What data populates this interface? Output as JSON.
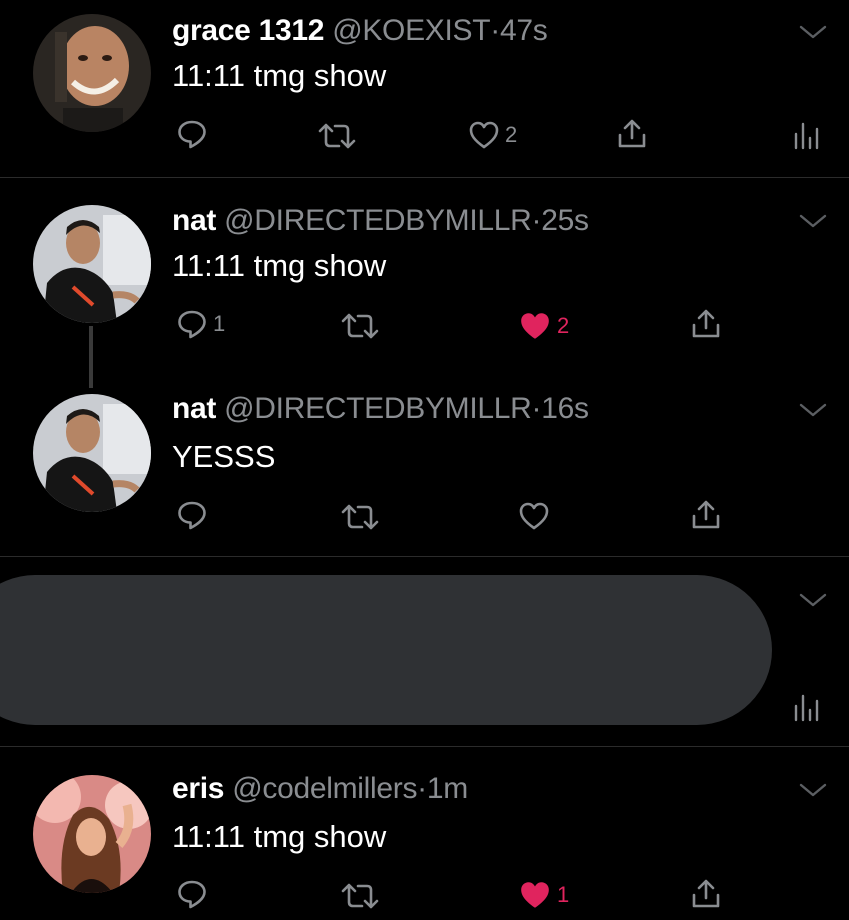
{
  "tweets": [
    {
      "name": "grace 1312",
      "handle": "@KOEXIST",
      "sep": "·",
      "time": "47s",
      "text": "11:11 tmg show",
      "reply_count": "",
      "like_count": "2"
    },
    {
      "name": "nat",
      "handle": "@DIRECTEDBYMILLR",
      "sep": "·",
      "time": "25s",
      "text": "11:11 tmg show",
      "reply_count": "1",
      "like_count": "2"
    },
    {
      "name": "nat",
      "handle": "@DIRECTEDBYMILLR",
      "sep": "·",
      "time": "16s",
      "text": "YESSS",
      "reply_count": "",
      "like_count": ""
    },
    {
      "name": "eris",
      "handle": "@codelmillers",
      "sep": "·",
      "time": "1m",
      "text": "11:11 tmg show",
      "reply_count": "",
      "like_count": "1"
    }
  ],
  "colors": {
    "background": "#000000",
    "secondary_text": "#8a8d91",
    "like_active": "#e0245e",
    "redacted_block": "#2f3134"
  },
  "icons": [
    "reply-icon",
    "retweet-icon",
    "like-icon",
    "share-icon",
    "analytics-icon",
    "chevron-down-icon"
  ]
}
